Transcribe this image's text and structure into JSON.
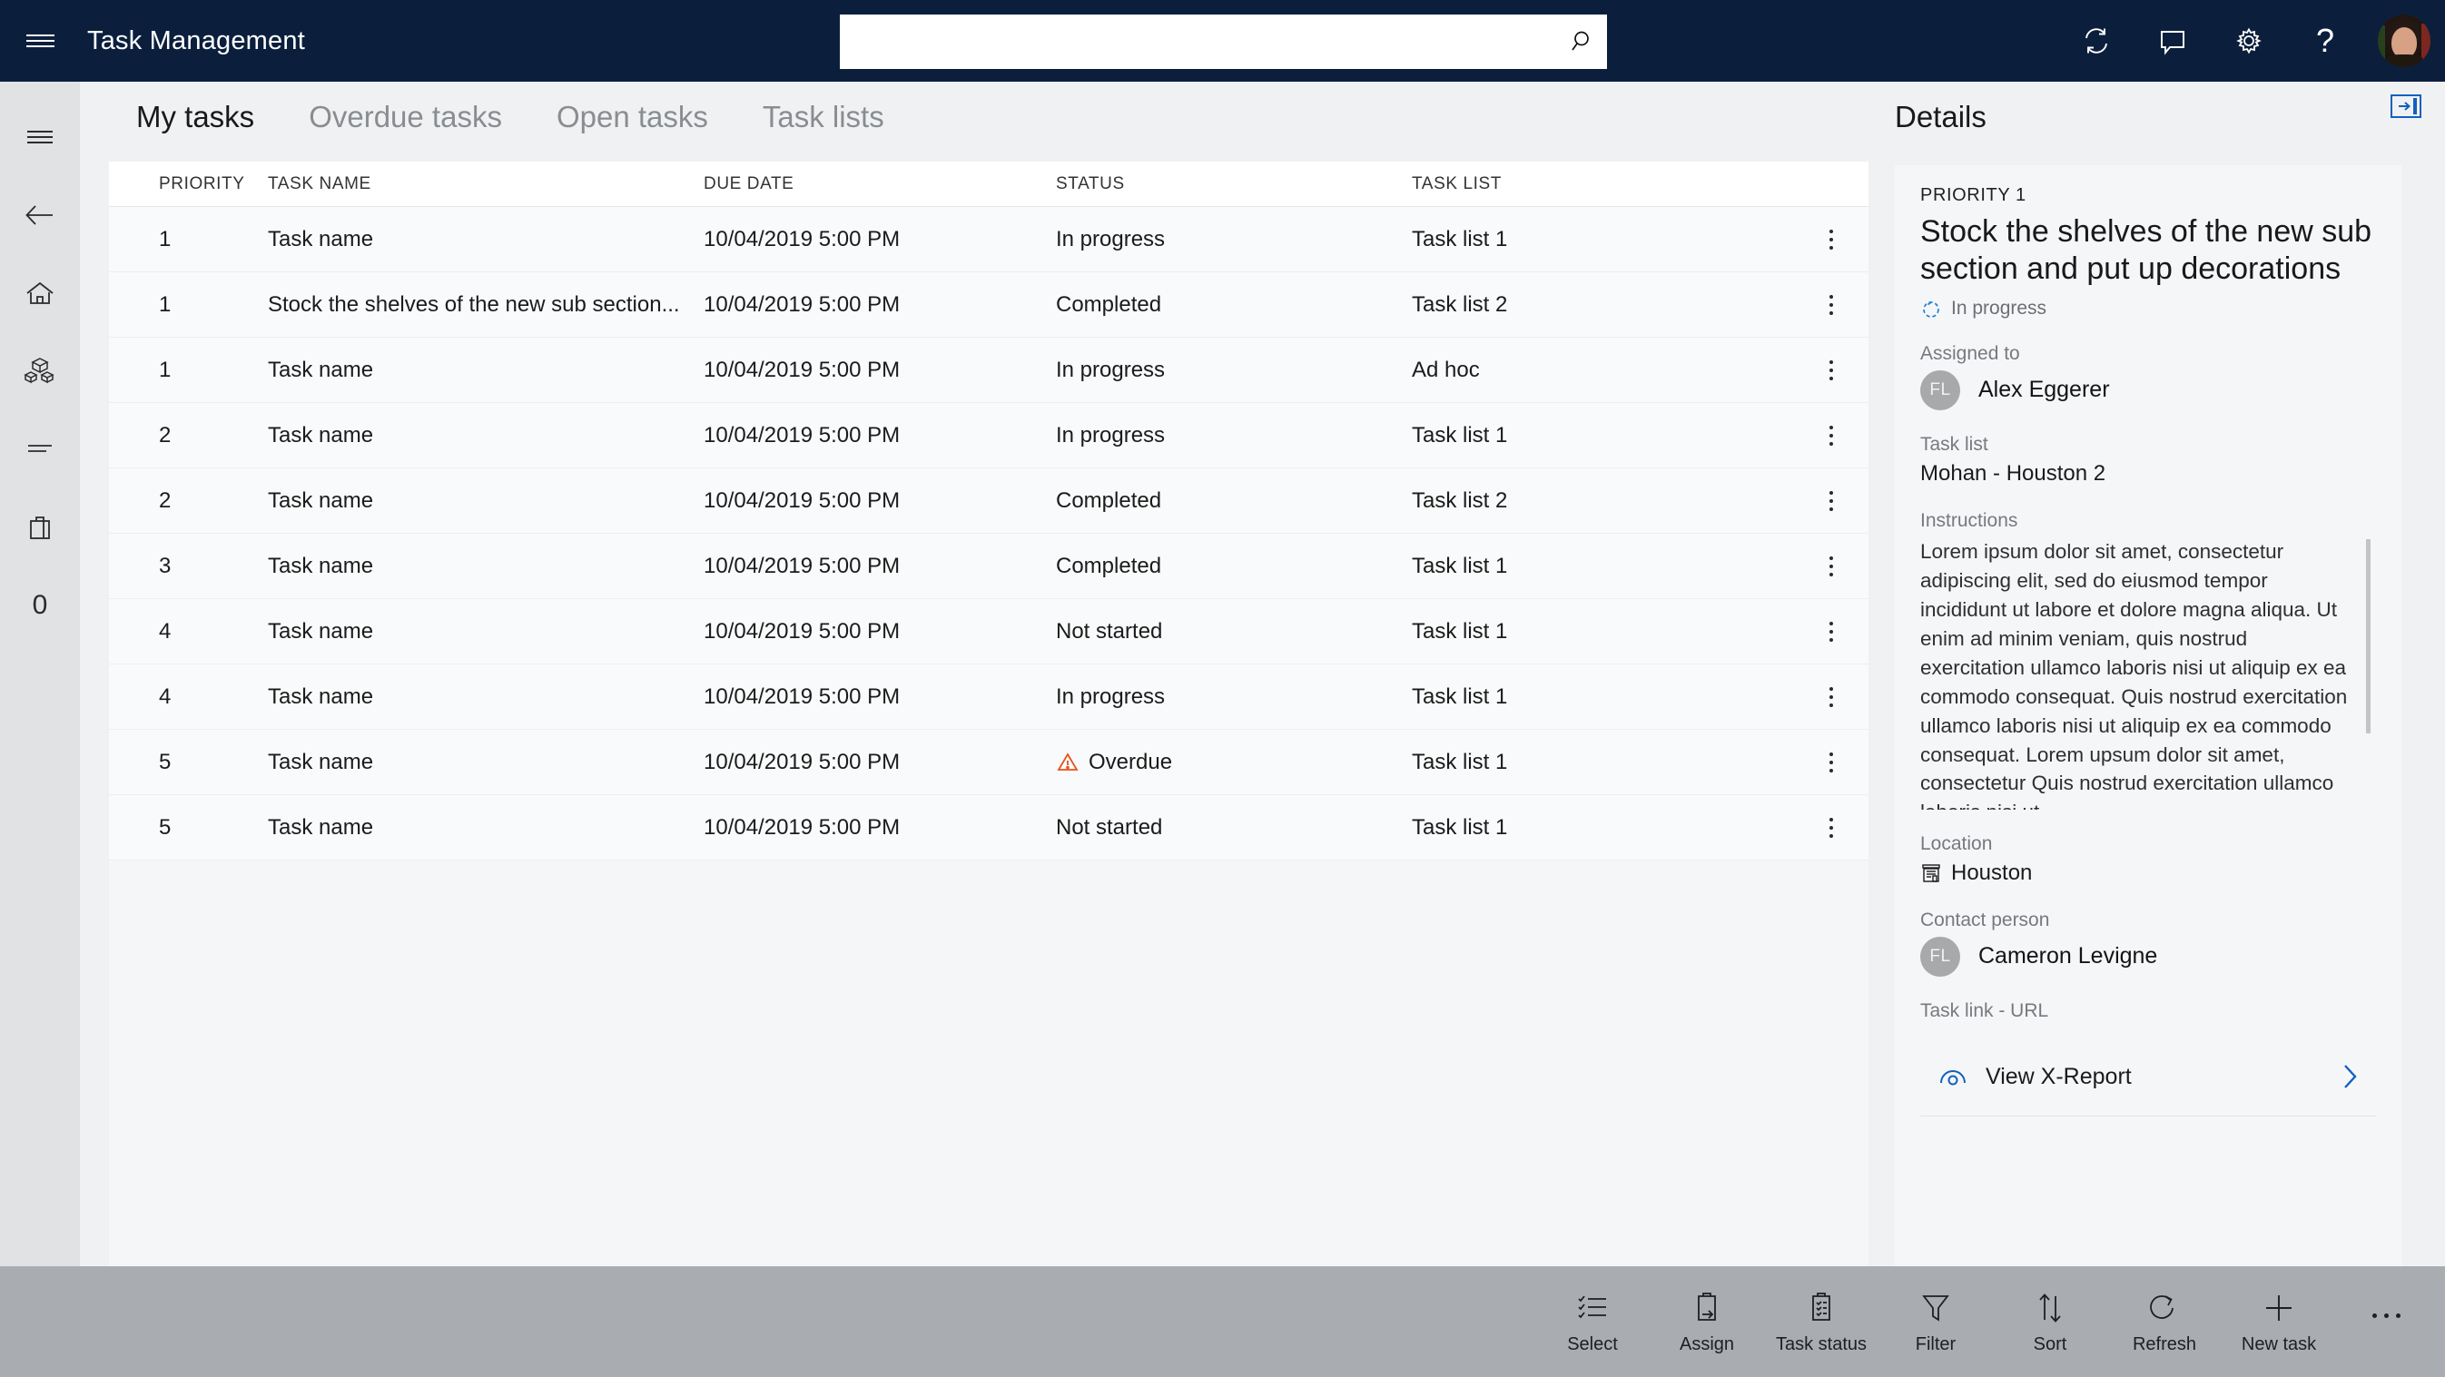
{
  "topbar": {
    "app_title": "Task Management",
    "hamburger_icon": "hamburger-menu-icon",
    "search_value": "",
    "search_placeholder": "",
    "search_icon": "search-magnifier-icon",
    "icons": [
      {
        "name": "refresh-sync-icon",
        "label": "Refresh"
      },
      {
        "name": "message-chat-icon",
        "label": "Messages"
      },
      {
        "name": "gear-settings-icon",
        "label": "Settings"
      },
      {
        "name": "help-question-icon",
        "label": "?"
      }
    ],
    "avatar_alt": "User profile photo"
  },
  "rail": {
    "items": [
      {
        "name": "hamburger-menu-icon",
        "label": "Menu"
      },
      {
        "name": "back-arrow-icon",
        "label": "Back"
      },
      {
        "name": "home-icon",
        "label": "Home"
      },
      {
        "name": "products-cubes-icon",
        "label": "Products"
      },
      {
        "name": "list-lines-icon",
        "label": "Lists"
      },
      {
        "name": "bag-icon",
        "label": "Bag"
      },
      {
        "name": "counter-zero",
        "label": "0"
      }
    ]
  },
  "tabs": [
    {
      "label": "My tasks",
      "active": true
    },
    {
      "label": "Overdue tasks",
      "active": false
    },
    {
      "label": "Open tasks",
      "active": false
    },
    {
      "label": "Task lists",
      "active": false
    }
  ],
  "grid": {
    "columns": [
      "PRIORITY",
      "TASK NAME",
      "DUE DATE",
      "STATUS",
      "TASK LIST"
    ],
    "rows": [
      {
        "priority": "1",
        "task_name": "Task name",
        "due_date": "10/04/2019 5:00 PM",
        "status": "In progress",
        "task_list": "Task list 1",
        "overdue": false
      },
      {
        "priority": "1",
        "task_name": "Stock the shelves of the new sub section...",
        "due_date": "10/04/2019 5:00 PM",
        "status": "Completed",
        "task_list": "Task list 2",
        "overdue": false
      },
      {
        "priority": "1",
        "task_name": "Task name",
        "due_date": "10/04/2019 5:00 PM",
        "status": "In progress",
        "task_list": "Ad hoc",
        "overdue": false
      },
      {
        "priority": "2",
        "task_name": "Task name",
        "due_date": "10/04/2019 5:00 PM",
        "status": "In progress",
        "task_list": "Task list 1",
        "overdue": false
      },
      {
        "priority": "2",
        "task_name": "Task name",
        "due_date": "10/04/2019 5:00 PM",
        "status": "Completed",
        "task_list": "Task list 2",
        "overdue": false
      },
      {
        "priority": "3",
        "task_name": "Task name",
        "due_date": "10/04/2019 5:00 PM",
        "status": "Completed",
        "task_list": "Task list 1",
        "overdue": false
      },
      {
        "priority": "4",
        "task_name": "Task name",
        "due_date": "10/04/2019 5:00 PM",
        "status": "Not started",
        "task_list": "Task list 1",
        "overdue": false
      },
      {
        "priority": "4",
        "task_name": "Task name",
        "due_date": "10/04/2019 5:00 PM",
        "status": "In progress",
        "task_list": "Task list 1",
        "overdue": false
      },
      {
        "priority": "5",
        "task_name": "Task name",
        "due_date": "10/04/2019 5:00 PM",
        "status": "Overdue",
        "task_list": "Task list 1",
        "overdue": true
      },
      {
        "priority": "5",
        "task_name": "Task name",
        "due_date": "10/04/2019 5:00 PM",
        "status": "Not started",
        "task_list": "Task list 1",
        "overdue": false
      }
    ],
    "row_menu_icon": "kebab-more-icon"
  },
  "details": {
    "panel_title": "Details",
    "collapse_icon": "collapse-panel-right-icon",
    "priority_label": "PRIORITY 1",
    "task_title": "Stock the shelves of the new sub section and put up decorations",
    "status_icon": "in-progress-circle-icon",
    "status_text": "In progress",
    "assigned_to_label": "Assigned to",
    "assigned_to_initials": "FL",
    "assigned_to_name": "Alex Eggerer",
    "task_list_label": "Task list",
    "task_list_value": "Mohan - Houston 2",
    "instructions_label": "Instructions",
    "instructions_text": "Lorem ipsum dolor sit amet, consectetur adipiscing elit, sed do eiusmod tempor incididunt ut labore et dolore magna aliqua. Ut enim ad minim veniam, quis nostrud exercitation ullamco laboris nisi ut aliquip ex ea commodo consequat. Quis nostrud exercitation ullamco laboris nisi ut aliquip ex ea commodo consequat. Lorem upsum dolor sit amet, consectetur Quis nostrud exercitation ullamco laboris nisi ut",
    "location_label": "Location",
    "location_icon": "store-building-icon",
    "location_value": "Houston",
    "contact_person_label": "Contact person",
    "contact_initials": "FL",
    "contact_name": "Cameron Levigne",
    "task_link_label": "Task link - URL",
    "task_link_icon": "report-eye-icon",
    "task_link_text": "View X-Report",
    "task_link_chevron": "chevron-right-icon"
  },
  "toolbar": {
    "items": [
      {
        "label": "Select",
        "icon": "select-list-icon"
      },
      {
        "label": "Assign",
        "icon": "assign-clipboard-icon"
      },
      {
        "label": "Task status",
        "icon": "task-status-clipboard-icon"
      },
      {
        "label": "Filter",
        "icon": "filter-funnel-icon"
      },
      {
        "label": "Sort",
        "icon": "sort-arrows-icon"
      },
      {
        "label": "Refresh",
        "icon": "refresh-circle-icon"
      },
      {
        "label": "New task",
        "icon": "plus-icon"
      }
    ],
    "more_icon": "overflow-ellipsis-icon"
  },
  "colors": {
    "topbar": "#0b1f3d",
    "rail": "#e1e2e3",
    "content_bg": "#f0f1f3",
    "card_bg": "#f5f6f8",
    "accent_blue": "#1060c0",
    "overdue_red": "#e8521f",
    "toolbar_bg": "#a9adb1"
  }
}
